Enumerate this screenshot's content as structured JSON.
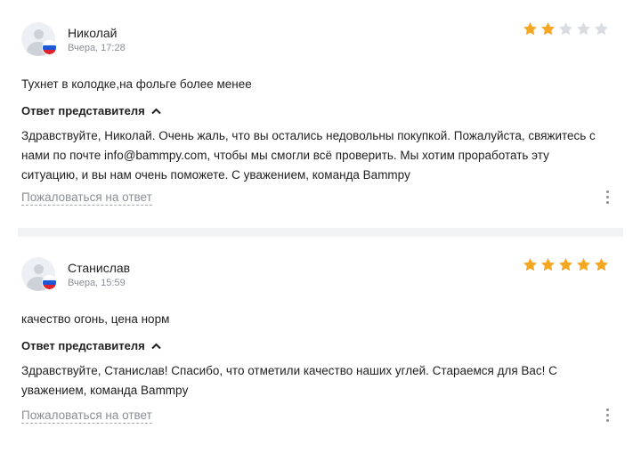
{
  "reviews": [
    {
      "author": "Николай",
      "date": "Вчера, 17:28",
      "rating": 2,
      "rating_max": 5,
      "text": "Тухнет в колодке,на фольге более менее",
      "answer_toggle": "Ответ представителя",
      "answer": "Здравствуйте, Николай. Очень жаль, что вы остались недовольны покупкой. Пожалуйста, свяжитесь с нами по почте info@bammpy.com, чтобы мы смогли всё проверить. Мы хотим проработать эту ситуацию, и вы нам очень поможете. С уважением, команда Bammpy",
      "complain": "Пожаловаться на ответ"
    },
    {
      "author": "Станислав",
      "date": "Вчера, 15:59",
      "rating": 5,
      "rating_max": 5,
      "text": "качество огонь, цена норм",
      "answer_toggle": "Ответ представителя",
      "answer": "Здравствуйте, Станислав! Спасибо, что отметили качество наших углей. Стараемся для Вас! С уважением, команда Bammpy",
      "complain": "Пожаловаться на ответ"
    }
  ],
  "colors": {
    "star_filled": "#f5a623",
    "star_empty": "#d9dce0",
    "flag": [
      "#ffffff",
      "#1c57d5",
      "#e0202c"
    ]
  },
  "icons": [
    "user-avatar-icon",
    "russia-flag-icon",
    "star-icon",
    "chevron-up-icon",
    "more-vertical-icon"
  ]
}
